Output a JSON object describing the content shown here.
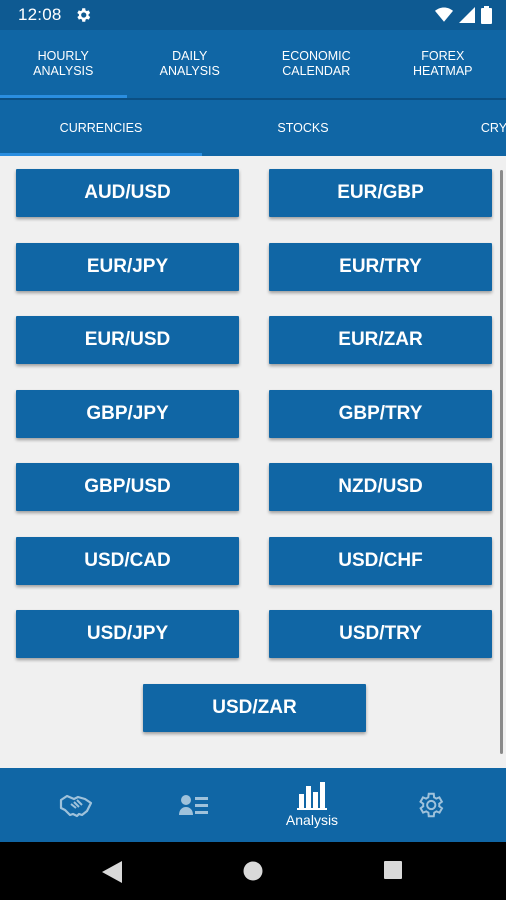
{
  "status_bar": {
    "time": "12:08"
  },
  "top_tabs": [
    {
      "label": "Hourly\nAnalysis",
      "active": true
    },
    {
      "label": "Daily\nAnalysis",
      "active": false
    },
    {
      "label": "Economic\nCalendar",
      "active": false
    },
    {
      "label": "Forex\nHeatmap",
      "active": false
    }
  ],
  "sub_tabs": [
    {
      "label": "Currencies",
      "active": true
    },
    {
      "label": "Stocks",
      "active": false
    },
    {
      "label": "Cry",
      "active": false
    }
  ],
  "pairs": [
    "AUD/USD",
    "EUR/GBP",
    "EUR/JPY",
    "EUR/TRY",
    "EUR/USD",
    "EUR/ZAR",
    "GBP/JPY",
    "GBP/TRY",
    "GBP/USD",
    "NZD/USD",
    "USD/CAD",
    "USD/CHF",
    "USD/JPY",
    "USD/TRY",
    "USD/ZAR"
  ],
  "bottom_nav": {
    "items": [
      {
        "icon": "handshake-icon",
        "label": ""
      },
      {
        "icon": "contacts-list-icon",
        "label": ""
      },
      {
        "icon": "bar-chart-icon",
        "label": "Analysis"
      },
      {
        "icon": "gear-icon",
        "label": ""
      }
    ],
    "active_index": 2
  },
  "colors": {
    "primary": "#1066a5",
    "status_bar": "#0e5a92",
    "background": "#f0f0f0",
    "tab_indicator": "#2a8ee0"
  }
}
